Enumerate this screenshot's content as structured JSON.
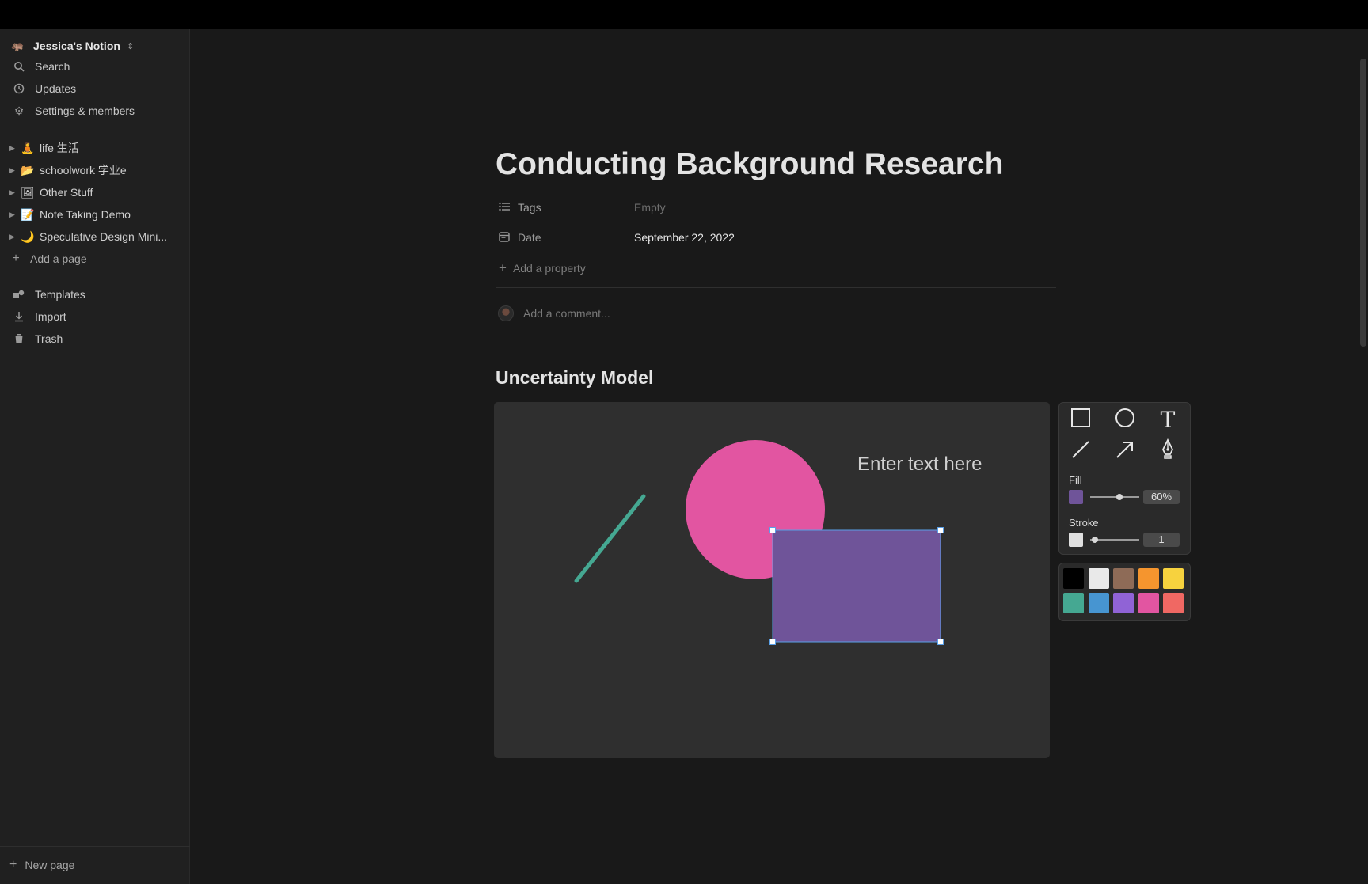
{
  "workspace": {
    "name": "Jessica's Notion",
    "logo": "tapir-emoji",
    "switch_icon": "⌃⌄"
  },
  "nav": [
    {
      "label": "Search",
      "icon": "search-icon"
    },
    {
      "label": "Updates",
      "icon": "clock-icon"
    },
    {
      "label": "Settings & members",
      "icon": "gear-icon"
    }
  ],
  "pages": [
    {
      "emoji": "🧘",
      "label": "life 生活"
    },
    {
      "emoji": "📂",
      "label": "schoolwork 学业e"
    },
    {
      "emoji": "🖼",
      "label": "Other Stuff"
    },
    {
      "emoji": "📝",
      "label": "Note Taking Demo"
    },
    {
      "emoji": "🌙",
      "label": "Speculative Design Mini..."
    }
  ],
  "add_page": "Add a page",
  "tools_nav": [
    {
      "label": "Templates",
      "icon": "templates-icon"
    },
    {
      "label": "Import",
      "icon": "import-icon"
    },
    {
      "label": "Trash",
      "icon": "trash-icon"
    }
  ],
  "new_page": "New page",
  "page": {
    "title": "Conducting Background Research",
    "properties": [
      {
        "name": "Tags",
        "value": "Empty",
        "icon": "list-icon"
      },
      {
        "name": "Date",
        "value": "September 22, 2022",
        "icon": "calendar-icon"
      }
    ],
    "add_property": "Add a property",
    "comment_placeholder": "Add a comment...",
    "heading": "Uncertainty Model"
  },
  "canvas": {
    "text": "Enter text here",
    "colors": {
      "background": "#2f2f2f",
      "line": "#45a892",
      "circle": "#e255a1",
      "rect": "#6f5499",
      "selection": "#5aa0e8"
    }
  },
  "panel": {
    "tools": [
      "rectangle-icon",
      "circle-icon",
      "text-icon",
      "line-icon",
      "arrow-icon",
      "pen-icon"
    ],
    "fill_label": "Fill",
    "fill_value": "60%",
    "fill_level": 0.6,
    "fill_color": "#6f5499",
    "stroke_label": "Stroke",
    "stroke_value": "1",
    "stroke_color": "#e0e0e0",
    "palette": [
      "#000000",
      "#e9e9e9",
      "#8e6b57",
      "#f5952e",
      "#f7d23e",
      "#45a892",
      "#4795d1",
      "#9063d6",
      "#e255a1",
      "#f06863"
    ]
  }
}
